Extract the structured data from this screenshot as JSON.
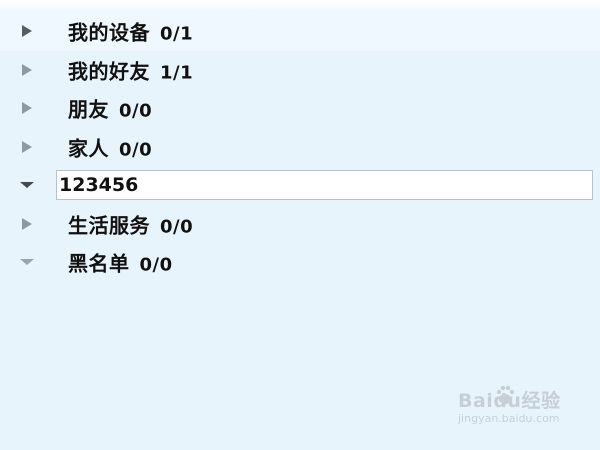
{
  "groups": [
    {
      "label": "我的设备",
      "count": "0/1",
      "state": "collapsed"
    },
    {
      "label": "我的好友",
      "count": "1/1",
      "state": "collapsed"
    },
    {
      "label": "朋友",
      "count": "0/0",
      "state": "collapsed"
    },
    {
      "label": "家人",
      "count": "0/0",
      "state": "collapsed"
    },
    {
      "label": "生活服务",
      "count": "0/0",
      "state": "collapsed"
    },
    {
      "label": "黑名单",
      "count": "0/0",
      "state": "expanded"
    }
  ],
  "editing_group": {
    "value": "123456",
    "state": "expanded"
  },
  "watermark": {
    "text": "Baidu经验",
    "subtext": "jingyan.baidu.com"
  },
  "colors": {
    "background": "#e8f4fc",
    "arrow": "#8e9aa3",
    "input_border": "#b7c3cc"
  }
}
